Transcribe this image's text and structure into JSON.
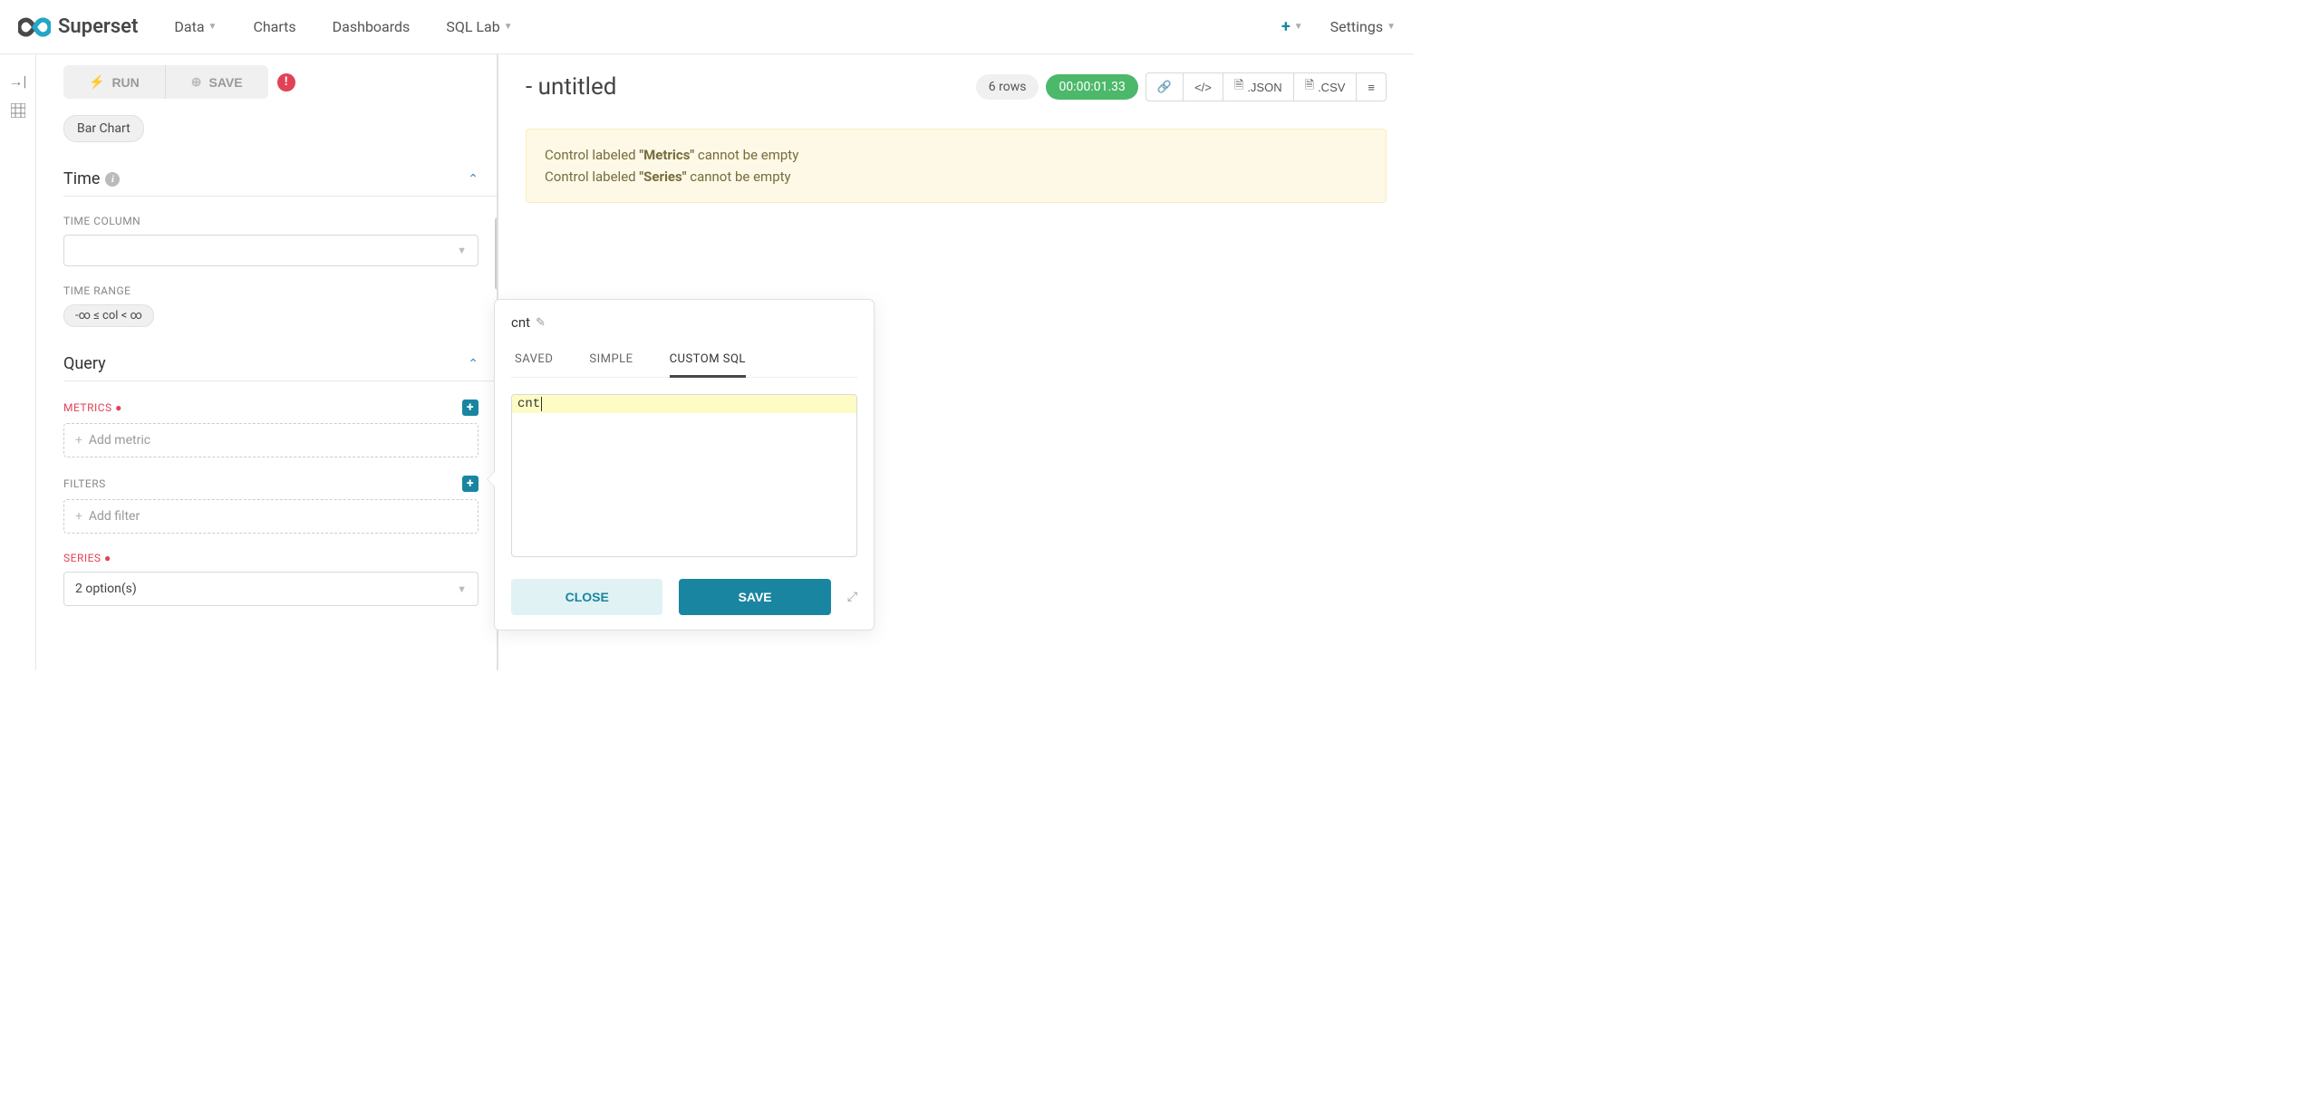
{
  "brand": "Superset",
  "nav": {
    "data": "Data",
    "charts": "Charts",
    "dashboards": "Dashboards",
    "sqllab": "SQL Lab",
    "settings": "Settings"
  },
  "actions": {
    "run": "RUN",
    "save": "SAVE"
  },
  "viz_type": "Bar Chart",
  "sections": {
    "time": {
      "title": "Time",
      "time_column_label": "TIME COLUMN",
      "time_range_label": "TIME RANGE",
      "time_range_value": "-∞ ≤ col < ∞"
    },
    "query": {
      "title": "Query",
      "metrics_label": "METRICS",
      "add_metric_placeholder": "Add metric",
      "filters_label": "FILTERS",
      "add_filter_placeholder": "Add filter",
      "series_label": "SERIES",
      "series_value": "2 option(s)"
    }
  },
  "chart": {
    "title": "- untitled",
    "rows": "6 rows",
    "time": "00:00:01.33",
    "json_btn": ".JSON",
    "csv_btn": ".CSV"
  },
  "warnings": {
    "prefix": "Control labeled ",
    "suffix": " cannot be empty",
    "metrics": "\"Metrics\"",
    "series": "\"Series\""
  },
  "popover": {
    "title": "cnt",
    "tabs": {
      "saved": "SAVED",
      "simple": "SIMPLE",
      "custom": "CUSTOM SQL"
    },
    "sql_value": "cnt",
    "close": "CLOSE",
    "save": "SAVE"
  }
}
